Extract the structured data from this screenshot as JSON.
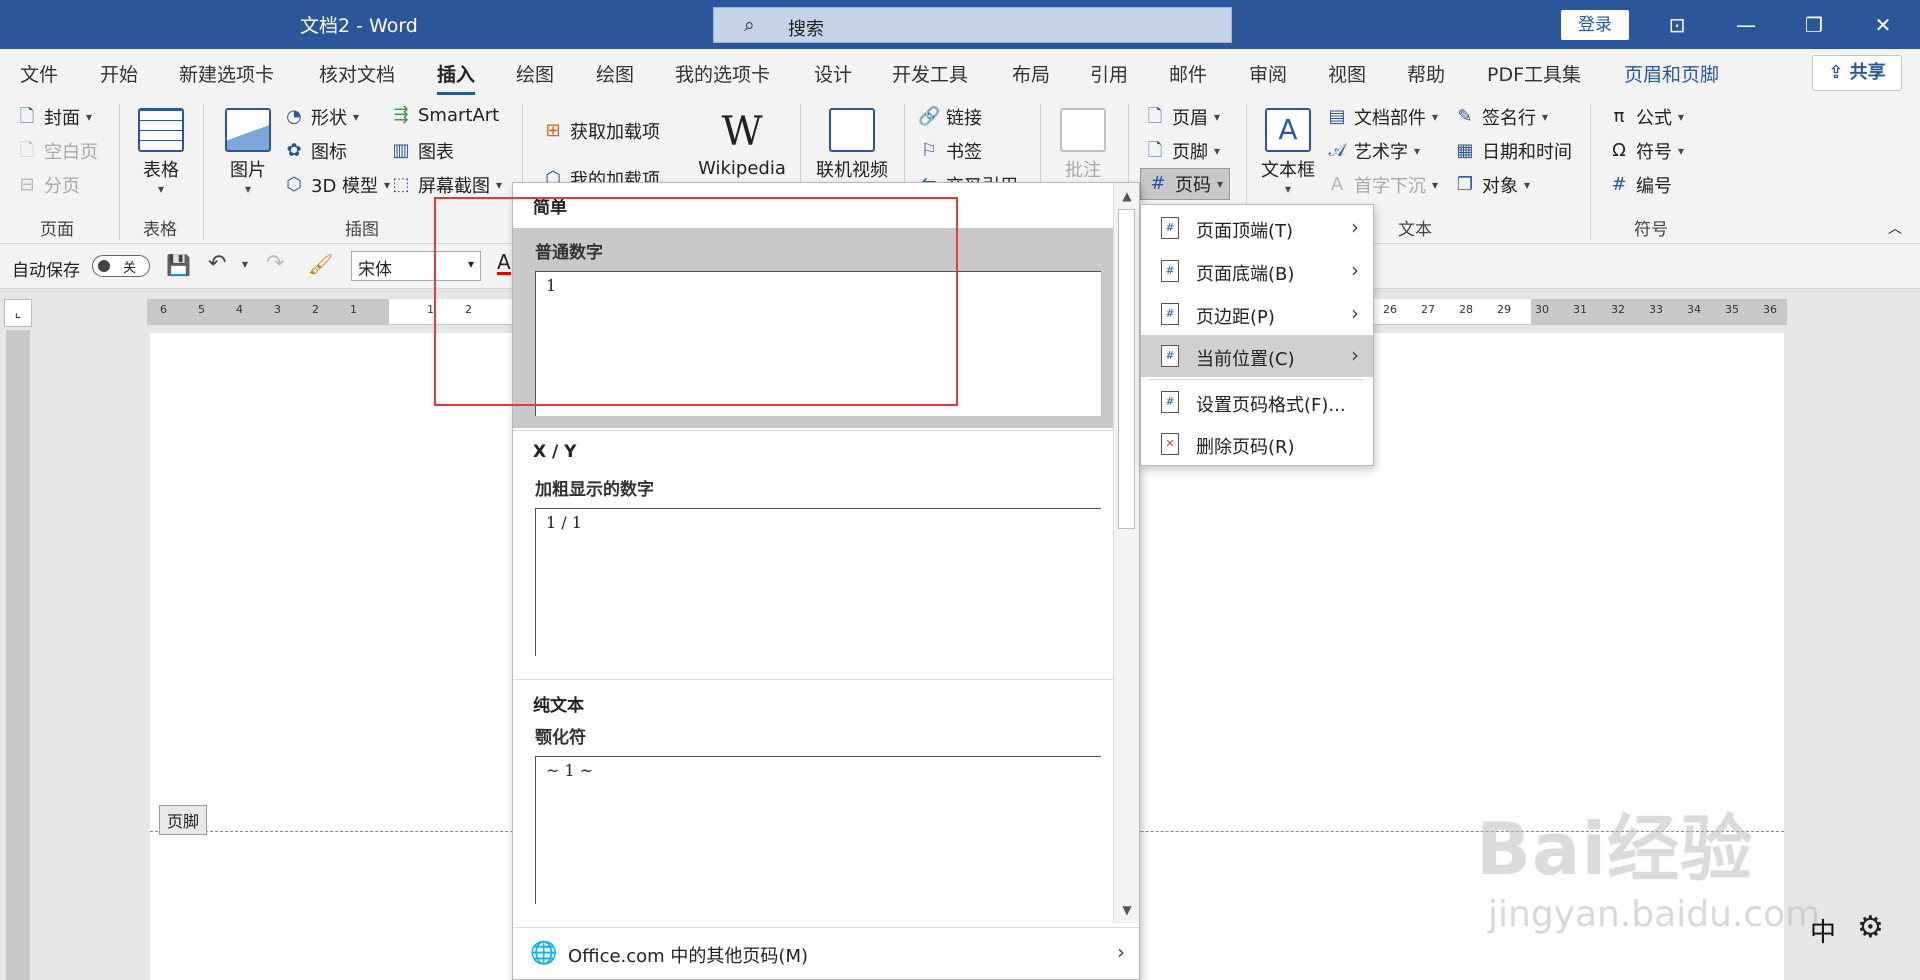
{
  "window": {
    "title": "文档2  -  Word",
    "search_placeholder": "搜索",
    "login_label": "登录",
    "controls": [
      "⊡",
      "—",
      "❐",
      "✕"
    ]
  },
  "tabs": [
    "文件",
    "开始",
    "新建选项卡",
    "核对文档",
    "插入",
    "绘图",
    "绘图",
    "我的选项卡",
    "设计",
    "开发工具",
    "布局",
    "引用",
    "邮件",
    "审阅",
    "视图",
    "帮助",
    "PDF工具集",
    "页眉和页脚"
  ],
  "share_label": "共享",
  "ribbon": {
    "page": {
      "cover": "封面",
      "blank": "空白页",
      "break": "分页",
      "label": "页面"
    },
    "table": {
      "btn": "表格",
      "label": "表格"
    },
    "illustrations": {
      "picture": "图片",
      "shapes": "形状",
      "icons": "图标",
      "model3d": "3D 模型",
      "smartart": "SmartArt",
      "chart": "图表",
      "screenshot": "屏幕截图",
      "label": "插图"
    },
    "addins": {
      "get": "获取加载项",
      "mine": "我的加载项",
      "wikipedia": "Wikipedia"
    },
    "media": {
      "video": "联机视频"
    },
    "links": {
      "link": "链接",
      "bookmark": "书签",
      "crossref": "交叉引用"
    },
    "comments": {
      "comment": "批注"
    },
    "header_footer": {
      "header": "页眉",
      "footer": "页脚",
      "page_number": "页码"
    },
    "text": {
      "textbox": "文本框",
      "parts": "文档部件",
      "wordart": "艺术字",
      "dropcap": "首字下沉",
      "signature": "签名行",
      "datetime": "日期和时间",
      "object": "对象",
      "label": "文本"
    },
    "symbols": {
      "equation": "公式",
      "symbol": "符号",
      "number": "编号",
      "label": "符号"
    }
  },
  "qat": {
    "autosave": "自动保存",
    "toggle": "关",
    "font": "宋体"
  },
  "ruler": {
    "left": [
      "6",
      "5",
      "4",
      "3",
      "2",
      "1",
      "1",
      "2"
    ],
    "right": [
      "26",
      "27",
      "28",
      "29",
      "30",
      "31",
      "32",
      "33",
      "34",
      "35",
      "36"
    ]
  },
  "document": {
    "footer_tag": "页脚"
  },
  "gallery": {
    "section1": "简单",
    "item1_name": "普通数字",
    "item1_preview": "1",
    "section2": "X / Y",
    "item2_name": "加粗显示的数字",
    "item2_preview": "1 / 1",
    "section3": "纯文本",
    "item3_name": "颚化符",
    "item3_preview": "~ 1 ~",
    "more": "Office.com 中的其他页码(M)"
  },
  "menu": {
    "items": [
      "页面顶端(T)",
      "页面底端(B)",
      "页边距(P)",
      "当前位置(C)",
      "设置页码格式(F)...",
      "删除页码(R)"
    ]
  },
  "bottom": {
    "ime": "中"
  },
  "watermark": {
    "brand": "Bai经验",
    "url": "jingyan.baidu.com"
  },
  "colors": {
    "accent": "#2b579a",
    "highlight_box": "#e53935"
  }
}
